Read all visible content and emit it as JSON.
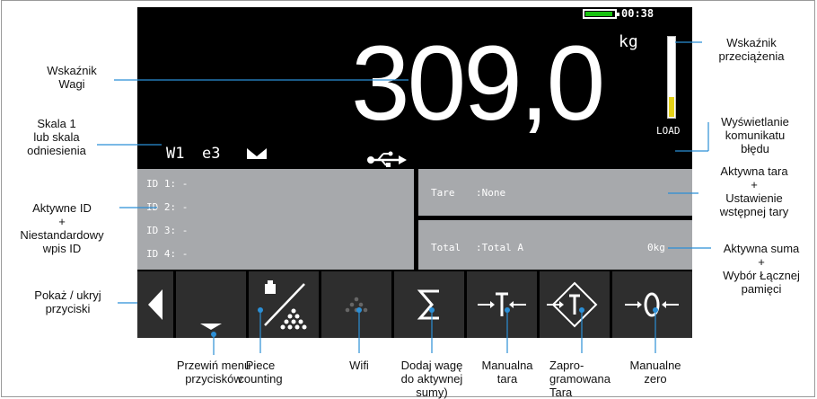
{
  "status": {
    "clock": "00:38"
  },
  "display": {
    "weight": "309,0",
    "unit": "kg",
    "load_label": "LOAD",
    "load_level": 0.25,
    "scale": "W1",
    "division": "e3"
  },
  "ids": [
    "ID 1: -",
    "ID 2: -",
    "ID 3: -",
    "ID 4: -"
  ],
  "tare": {
    "label": "Tare",
    "value": ":None"
  },
  "total": {
    "label": "Total",
    "value": ":Total A",
    "amount": "0kg"
  },
  "buttons": [
    {
      "name": "show-hide-buttons",
      "icon": "triangle-left-icon"
    },
    {
      "name": "scroll-menu",
      "icon": "chevron-down-icon"
    },
    {
      "name": "piece-counting",
      "icon": "piece-count-icon"
    },
    {
      "name": "wifi",
      "icon": "dots-wifi-icon"
    },
    {
      "name": "add-to-total",
      "icon": "sigma-icon"
    },
    {
      "name": "manual-tare",
      "icon": "tare-icon"
    },
    {
      "name": "preset-tare",
      "icon": "preset-tare-icon"
    },
    {
      "name": "manual-zero",
      "icon": "zero-icon"
    }
  ],
  "callouts": {
    "weight_indicator": [
      "Wskaźnik",
      "Wagi"
    ],
    "scale_1": [
      "Skala 1",
      "lub skala",
      "odniesienia"
    ],
    "active_id": [
      "Aktywne ID",
      "+",
      "Niestandardowy",
      "wpis ID"
    ],
    "show_hide": [
      "Pokaż / ukryj",
      "przyciski"
    ],
    "overload": [
      "Wskaźnik",
      "przeciążenia"
    ],
    "error_msg": [
      "Wyświetlanie",
      "komunikatu",
      "błędu"
    ],
    "active_tare": [
      "Aktywna tara",
      "+",
      "Ustawienie",
      "wstępnej tary"
    ],
    "active_total": [
      "Aktywna suma",
      "+",
      "Wybór Łącznej",
      "pamięci"
    ],
    "scroll_menu": [
      "Przewiń menu",
      "przycisków"
    ],
    "piece": [
      "Piece",
      "counting"
    ],
    "wifi": [
      "Wifi"
    ],
    "add_weight": [
      "Dodaj wagę",
      "do aktywnej",
      "sumy)"
    ],
    "manual_tare": [
      "Manualna",
      "tara"
    ],
    "preset_tare": [
      "Zapro-",
      "gramowana",
      "Tara"
    ],
    "manual_zero": [
      "Manualne",
      "zero"
    ]
  },
  "colors": {
    "panel": "#a7a9ac",
    "button": "#2e2e2e",
    "callout_line": "#2b8fd6",
    "battery": "#18c20f",
    "load_fill": "#e5d117"
  }
}
